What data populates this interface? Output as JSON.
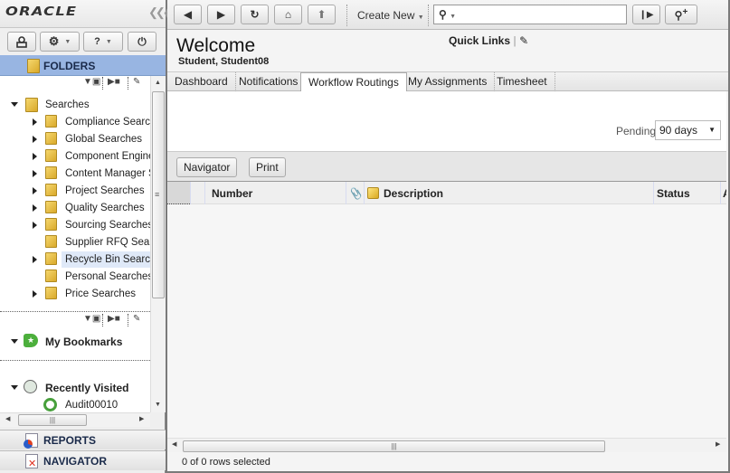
{
  "brand": {
    "logo": "ORACLE",
    "collapse_icon": "double-chevron-left"
  },
  "left_toolbar": {
    "user_icon": "user-icon",
    "settings_icon": "gear-icon",
    "help_label": "?",
    "power_icon": "power-icon"
  },
  "folders": {
    "title": "FOLDERS",
    "root": {
      "label": "Searches",
      "expanded": true
    },
    "items": [
      {
        "label": "Compliance Searches",
        "expandable": true,
        "selected": false
      },
      {
        "label": "Global Searches",
        "expandable": true,
        "selected": false
      },
      {
        "label": "Component Engineering Searches",
        "expandable": true,
        "selected": false
      },
      {
        "label": "Content Manager Searches",
        "expandable": true,
        "selected": false
      },
      {
        "label": "Project Searches",
        "expandable": true,
        "selected": false
      },
      {
        "label": "Quality Searches",
        "expandable": true,
        "selected": false
      },
      {
        "label": "Sourcing Searches",
        "expandable": true,
        "selected": false
      },
      {
        "label": "Supplier RFQ Searches",
        "expandable": false,
        "selected": false
      },
      {
        "label": "Recycle Bin Searches",
        "expandable": true,
        "selected": true
      },
      {
        "label": "Personal Searches",
        "expandable": false,
        "selected": false
      },
      {
        "label": "Price Searches",
        "expandable": true,
        "selected": false
      }
    ]
  },
  "bookmarks": {
    "title": "My Bookmarks"
  },
  "recent": {
    "title": "Recently Visited",
    "items": [
      {
        "label": "Audit00010"
      }
    ]
  },
  "bottom_nav": {
    "reports": "REPORTS",
    "navigator": "NAVIGATOR"
  },
  "topbar": {
    "create_new": "Create New",
    "search_placeholder": "",
    "buttons": [
      "back",
      "forward",
      "refresh",
      "home",
      "up"
    ]
  },
  "header": {
    "title": "Welcome",
    "user": "Student, Student08",
    "quick_links": "Quick Links"
  },
  "tabs": [
    {
      "label": "Dashboard",
      "active": false
    },
    {
      "label": "Notifications",
      "active": false
    },
    {
      "label": "Workflow Routings",
      "active": true
    },
    {
      "label": "My Assignments",
      "active": false
    },
    {
      "label": "Timesheet",
      "active": false
    }
  ],
  "filter": {
    "pending_label": "Pending:",
    "pending_value": "90 days"
  },
  "actions": {
    "navigator": "Navigator",
    "print": "Print"
  },
  "table": {
    "columns": [
      "Number",
      "Description",
      "Status",
      "A"
    ],
    "rows": []
  },
  "status": {
    "rows_selected": "0 of 0 rows selected"
  }
}
